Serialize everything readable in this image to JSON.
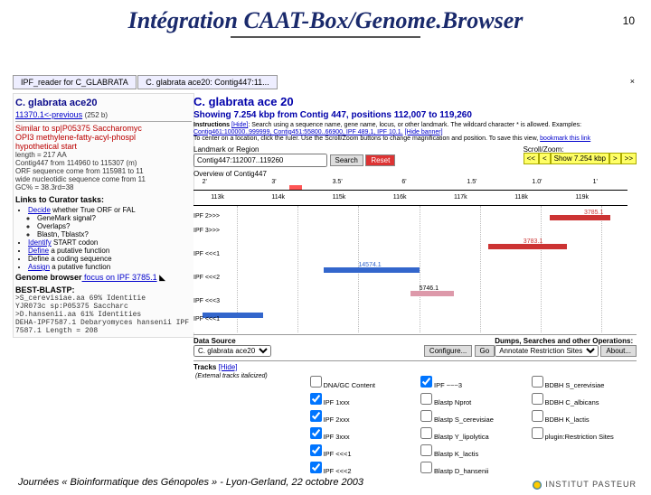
{
  "slide": {
    "title": "Intégration CAAT-Box/Genome.Browser",
    "page_number": "10",
    "footer": "Journées « Bioinformatique des Génopoles » - Lyon-Gerland, 22 octobre 2003",
    "logo_text": "INSTITUT PASTEUR"
  },
  "tabs": {
    "tab1": "IPF_reader for C_GLABRATA",
    "tab2": "C. glabrata ace20: Contig447:11...",
    "close": "×"
  },
  "left": {
    "title": "C. glabrata ace20",
    "prev_link": "11370.1<-previous",
    "prev_size": "(252 b)",
    "sim1": "Similar to sp|P05375 Saccharomyc",
    "sim2": "OPI3 methylene-fatty-acyl-phospl",
    "sim3": "hypothetical start",
    "len": "length = 217 AA",
    "loc": "Contig447 from 114960 to 115307 (m)",
    "orf": "ORF sequence come from 115981 to 11",
    "wide": "wide nucleotidic sequence come from 11",
    "gc": "GC% = 38.3rd=38",
    "links_hdr": "Links to Curator tasks:",
    "decide": "Decide",
    "decide_txt": " whether True ORF or FAL",
    "gm": "GeneMark signal?",
    "ov": "Overlaps?",
    "bl": "Blastn, Tblastx?",
    "start": "Identify",
    "start_txt": " START codon",
    "def": "Define",
    "def_txt": " a putative function",
    "cod": "Define a coding sequence",
    "assign": "Assign",
    "assign_txt": " a putative function",
    "gb_line": "Genome browser",
    "gb_focus": " focus on IPF 3785.1",
    "best": "BEST-BLASTP:",
    "bp1": ">S_cerevisiae.aa 69%   Identitie",
    "bp2": " YJR073c sp:P05375 Saccharc",
    "bp3": ">D.hansenii.aa 61%   Identities",
    "bp4": "DEHA-IPF7587.1 Debaryomyces hansenii IPF 7587.1      Length = 208"
  },
  "main": {
    "title": "C. glabrata ace 20",
    "showing": "Showing 7.254 kbp from Contig 447, positions 112,007 to 119,260",
    "instr_label": "Instructions",
    "hide": "[Hide]",
    "instr1": "Search using a sequence name, gene name, locus, or other landmark. The wildcard character * is allowed. Examples:",
    "instr2": "Contig461:100000..999999, Contig451:55800..66900, IPF 489.1, IPF 10.1.",
    "instr2b": "[Hide banner]",
    "instr3": "To center on a location, click the ruler. Use the Scroll/Zoom buttons to change magnification and position. To save this view,",
    "instr3b": "bookmark this link",
    "lm_label": "Landmark or Region",
    "search_value": "Contig447:112007..119260",
    "search_btn": "Search",
    "reset_btn": "Reset",
    "scroll_label": "Scroll/Zoom:",
    "zoom_left2": "<<",
    "zoom_left1": "<",
    "zoom_sel": "Show 7.254 kbp",
    "zoom_right1": ">",
    "zoom_right2": ">>",
    "overview": "Overview of Contig447",
    "ruler": {
      "r0": "2'",
      "r1": "3'",
      "r2": "3.5'",
      "r3": "6'",
      "r4": "1.5'",
      "r5": "1.0'",
      "r6": "1'"
    },
    "ruler2": {
      "t0": "113k",
      "t1": "114k",
      "t2": "115k",
      "t3": "116k",
      "t4": "117k",
      "t5": "118k",
      "t6": "119k"
    },
    "trk": {
      "t1": "IPF 2>>>",
      "t2": "IPF 3>>>",
      "t3": "IPF <<<1",
      "t4": "IPF <<<2",
      "t5": "IPF <<<3",
      "t6": "IPF <<<1"
    },
    "feat": {
      "f1": "3785.1",
      "f2": "3783.1",
      "f3": "14574.1",
      "f4": "5746.1"
    },
    "ds_label": "Data Source",
    "ds_value": "C. glabrata ace20",
    "dump_label": "Dumps, Searches and other Operations:",
    "dump_sel": "Annotate Restriction Sites",
    "about": "About...",
    "config": "Configure...",
    "go": "Go",
    "tracks_hdr": "Tracks",
    "tracks_hide": "[Hide]",
    "ext": "(External tracks italicized)",
    "col1": {
      "a": "DNA/GC Content",
      "b": "IPF 1xxx",
      "c": "IPF 2xxx",
      "d": "IPF 3xxx",
      "e": "IPF <<<1",
      "f": "IPF <<<2"
    },
    "col2": {
      "a": "IPF ~~~3",
      "b": "Blastp Nprot",
      "c": "Blastp S_cerevisiae",
      "d": "Blastp Y_lipolytica",
      "e": "Blastp K_lactis",
      "f": "Blastp D_hansenii"
    },
    "col3": {
      "a": "BDBH S_cerevisiae",
      "b": "BDBH C_albicans",
      "c": "BDBH K_lactis",
      "d": "plugin:Restriction Sites"
    }
  }
}
